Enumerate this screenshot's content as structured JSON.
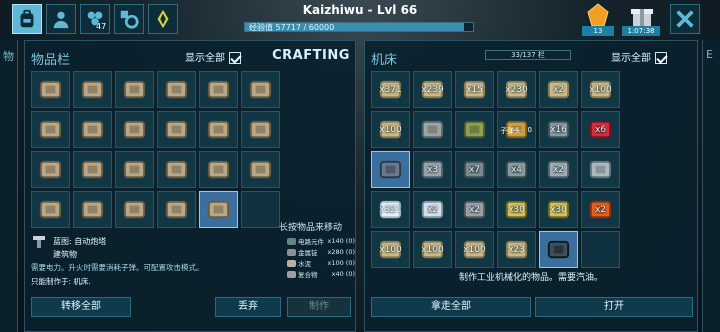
{
  "top": {
    "player_title": "Kaizhiwu - Lvl 66",
    "xp_text": "经验值 57717 / 60000",
    "xp_fraction": 0.962,
    "tribe_badge": "47",
    "gem_count": "13",
    "gift_timer": "1:07:38",
    "tabs": [
      {
        "name": "inventory-tab",
        "icon": "backpack-icon",
        "active": true
      },
      {
        "name": "character-tab",
        "icon": "person-icon",
        "active": false
      },
      {
        "name": "tribe-tab",
        "icon": "tribe-icon",
        "active": false
      },
      {
        "name": "engrams-tab",
        "icon": "engram-gear-icon",
        "active": false
      },
      {
        "name": "map-tab",
        "icon": "obelisk-icon",
        "active": false
      }
    ]
  },
  "left_panel": {
    "title": "物品栏",
    "show_all": "显示全部",
    "crafting_tab": "CRAFTING",
    "hint_move": "长按物品来移动",
    "slots": [
      {
        "icon": "thatch-roof-icon"
      },
      {
        "icon": "wooden-sign-icon"
      },
      {
        "icon": "bow-icon"
      },
      {
        "icon": "mortar-pestle-icon"
      },
      {
        "icon": "stone-pike-icon"
      },
      {
        "icon": "stone-foundation-icon"
      },
      {
        "icon": "wood-wall-icon"
      },
      {
        "icon": "wood-window-icon"
      },
      {
        "icon": "thatch-wall-icon"
      },
      {
        "icon": "wood-ramp-icon"
      },
      {
        "icon": "bandage-icon"
      },
      {
        "icon": "cloth-hat-icon"
      },
      {
        "icon": "cloth-gloves-icon"
      },
      {
        "icon": "sickle-icon"
      },
      {
        "icon": "spear-icon"
      },
      {
        "icon": "waterskin-icon"
      },
      {
        "icon": "chitin-shirt-icon"
      },
      {
        "icon": "chitin-pants-icon"
      },
      {
        "icon": "stone-hatchet-icon"
      },
      {
        "icon": "torch-icon"
      },
      {
        "icon": "campfire-icon"
      },
      {
        "icon": "leather-bag-icon"
      },
      {
        "icon": "auto-turret-icon",
        "selected": true
      },
      {
        "icon": ""
      }
    ],
    "blueprint": {
      "title": "蓝图: 自动炮塔",
      "category": "建筑物",
      "desc_line1": "需要电力。升火时需要消耗子弹。可配置攻击模式。",
      "only_craft": "只能制作于: 机床."
    },
    "requirements": [
      {
        "name": "电路元件",
        "amount": "x140 (0)",
        "color": "#6b7f86"
      },
      {
        "name": "金属锭",
        "amount": "x280 (0)",
        "color": "#8a8f93"
      },
      {
        "name": "水泥",
        "amount": "x100 (0)",
        "color": "#b7b2a8"
      },
      {
        "name": "复合物",
        "amount": "x40 (0)",
        "color": "#9aa0a8"
      }
    ],
    "buttons": {
      "transfer_all": "转移全部",
      "drop": "丢弃",
      "craft": "制作"
    }
  },
  "right_panel": {
    "title": "机床",
    "weight": "33/137 栏",
    "show_all": "显示全部",
    "slots": [
      {
        "icon": "blueprint-icon",
        "qty": "x371"
      },
      {
        "icon": "blueprint-icon",
        "qty": "x239"
      },
      {
        "icon": "blueprint-icon",
        "qty": "x15"
      },
      {
        "icon": "blueprint-icon",
        "qty": "x230"
      },
      {
        "icon": "blueprint-icon",
        "qty": "x2"
      },
      {
        "icon": "blueprint-icon",
        "qty": "x100"
      },
      {
        "icon": "blueprint-icon",
        "qty": "x100"
      },
      {
        "icon": "metal-ore-icon",
        "qty": ""
      },
      {
        "icon": "backpack-green-icon",
        "qty": ""
      },
      {
        "icon": "ammo-icon",
        "qty": "",
        "label": "子弹头",
        "num": "0"
      },
      {
        "icon": "silencer-icon",
        "qty": "x16"
      },
      {
        "icon": "red-object-icon",
        "qty": "x6"
      },
      {
        "icon": "scope-icon",
        "qty": "",
        "selected": true
      },
      {
        "icon": "cylinder-icon",
        "qty": "x3"
      },
      {
        "icon": "rifle-icon",
        "qty": "x7"
      },
      {
        "icon": "sniper-rifle-icon",
        "qty": "x4"
      },
      {
        "icon": "crossed-tools-icon",
        "qty": "x2"
      },
      {
        "icon": "metal-ring-icon",
        "qty": ""
      },
      {
        "icon": "crystal-icon",
        "qty": "x321"
      },
      {
        "icon": "silica-icon",
        "qty": "x2"
      },
      {
        "icon": "stone-icon",
        "qty": "x2"
      },
      {
        "icon": "pot-icon",
        "qty": "x30"
      },
      {
        "icon": "pot-icon",
        "qty": "x30"
      },
      {
        "icon": "gem-icon",
        "qty": "x2"
      },
      {
        "icon": "blueprint-icon",
        "qty": "x100"
      },
      {
        "icon": "blueprint-icon",
        "qty": "x100"
      },
      {
        "icon": "blueprint-icon",
        "qty": "x100"
      },
      {
        "icon": "blueprint-icon",
        "qty": "x23"
      },
      {
        "icon": "tablet-icon",
        "qty": "",
        "selected": true
      },
      {
        "icon": "",
        "qty": ""
      }
    ],
    "desc": "制作工业机械化的物品。需要汽油。",
    "buttons": {
      "take_all": "拿走全部",
      "open": "打开"
    }
  }
}
